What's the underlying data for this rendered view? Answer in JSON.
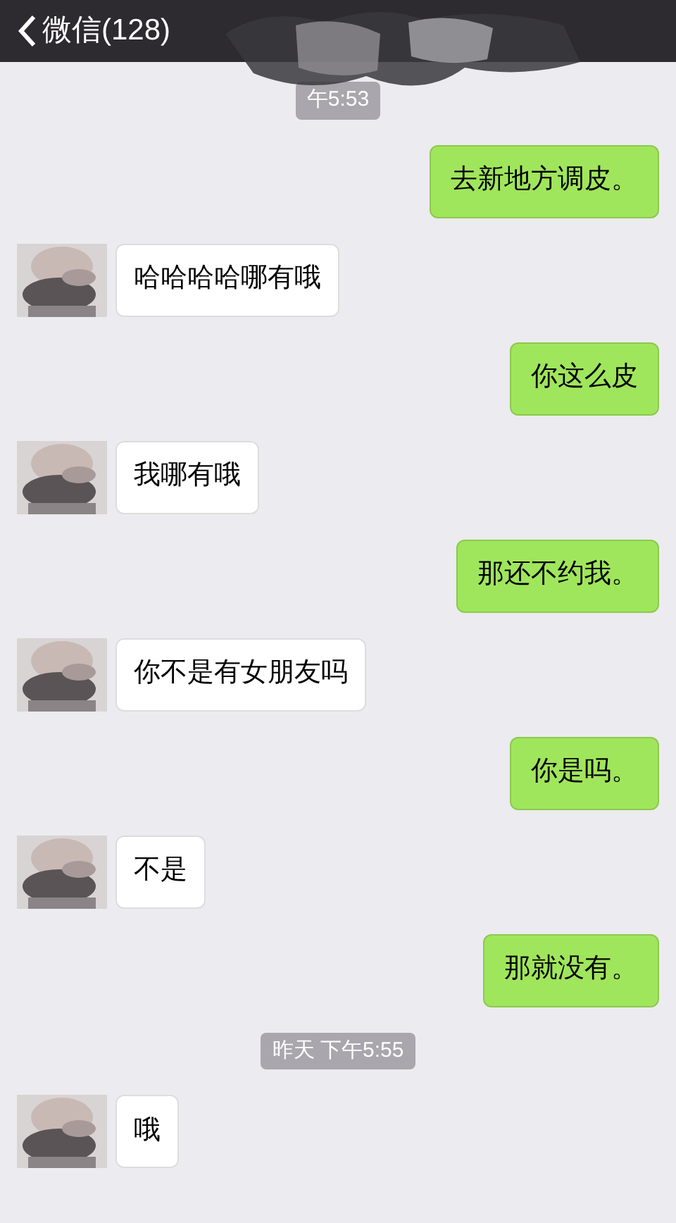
{
  "header": {
    "back_label": "微信(128)"
  },
  "messages": [
    {
      "kind": "time",
      "text": "午5:53"
    },
    {
      "kind": "sent",
      "text": "去新地方调皮。"
    },
    {
      "kind": "received",
      "text": "哈哈哈哈哪有哦"
    },
    {
      "kind": "sent",
      "text": "你这么皮"
    },
    {
      "kind": "received",
      "text": "我哪有哦"
    },
    {
      "kind": "sent",
      "text": "那还不约我。"
    },
    {
      "kind": "received",
      "text": "你不是有女朋友吗"
    },
    {
      "kind": "sent",
      "text": "你是吗。"
    },
    {
      "kind": "received",
      "text": "不是"
    },
    {
      "kind": "sent",
      "text": "那就没有。"
    },
    {
      "kind": "time",
      "text": "昨天 下午5:55"
    },
    {
      "kind": "received",
      "text": "哦"
    }
  ]
}
